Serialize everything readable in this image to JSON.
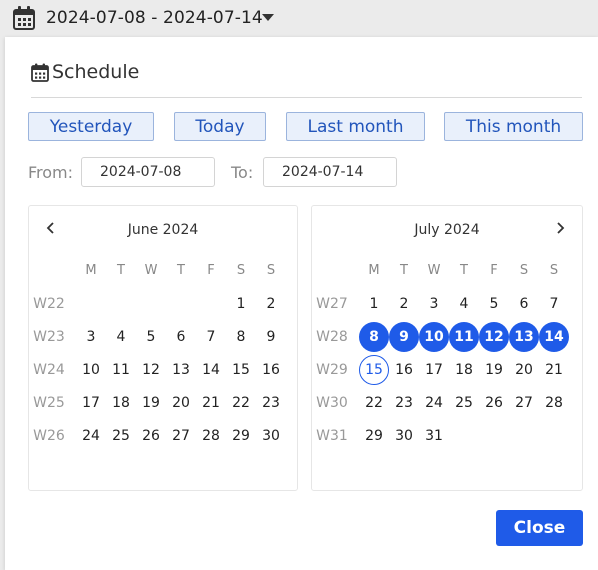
{
  "topbar": {
    "range_label": "2024-07-08 - 2024-07-14",
    "icon": "calendar-icon",
    "dropdown_icon": "caret-down-icon"
  },
  "panel": {
    "title": "Schedule",
    "title_icon": "calendar-icon"
  },
  "quick_ranges": {
    "yesterday": "Yesterday",
    "today": "Today",
    "last_month": "Last month",
    "this_month": "This month"
  },
  "range_inputs": {
    "from_label": "From:",
    "from_value": "2024-07-08",
    "to_label": "To:",
    "to_value": "2024-07-14"
  },
  "weekday_headers": [
    "M",
    "T",
    "W",
    "T",
    "F",
    "S",
    "S"
  ],
  "calendars": [
    {
      "title": "June 2024",
      "nav": "prev",
      "weeks": [
        {
          "week": "W22",
          "days": [
            "",
            "",
            "",
            "",
            "",
            "1",
            "2"
          ]
        },
        {
          "week": "W23",
          "days": [
            "3",
            "4",
            "5",
            "6",
            "7",
            "8",
            "9"
          ]
        },
        {
          "week": "W24",
          "days": [
            "10",
            "11",
            "12",
            "13",
            "14",
            "15",
            "16"
          ]
        },
        {
          "week": "W25",
          "days": [
            "17",
            "18",
            "19",
            "20",
            "21",
            "22",
            "23"
          ]
        },
        {
          "week": "W26",
          "days": [
            "24",
            "25",
            "26",
            "27",
            "28",
            "29",
            "30"
          ]
        }
      ]
    },
    {
      "title": "July 2024",
      "nav": "next",
      "weeks": [
        {
          "week": "W27",
          "days": [
            "1",
            "2",
            "3",
            "4",
            "5",
            "6",
            "7"
          ]
        },
        {
          "week": "W28",
          "days": [
            "8",
            "9",
            "10",
            "11",
            "12",
            "13",
            "14"
          ]
        },
        {
          "week": "W29",
          "days": [
            "15",
            "16",
            "17",
            "18",
            "19",
            "20",
            "21"
          ]
        },
        {
          "week": "W30",
          "days": [
            "22",
            "23",
            "24",
            "25",
            "26",
            "27",
            "28"
          ]
        },
        {
          "week": "W31",
          "days": [
            "29",
            "30",
            "31",
            "",
            "",
            "",
            ""
          ]
        }
      ],
      "selected_days": [
        "8",
        "9",
        "10",
        "11",
        "12",
        "13",
        "14"
      ],
      "today_day": "15"
    }
  ],
  "close_label": "Close",
  "colors": {
    "accent": "#1f5be8",
    "quick_button_bg": "#e9f0fb",
    "quick_button_border": "#9bb4dd"
  }
}
